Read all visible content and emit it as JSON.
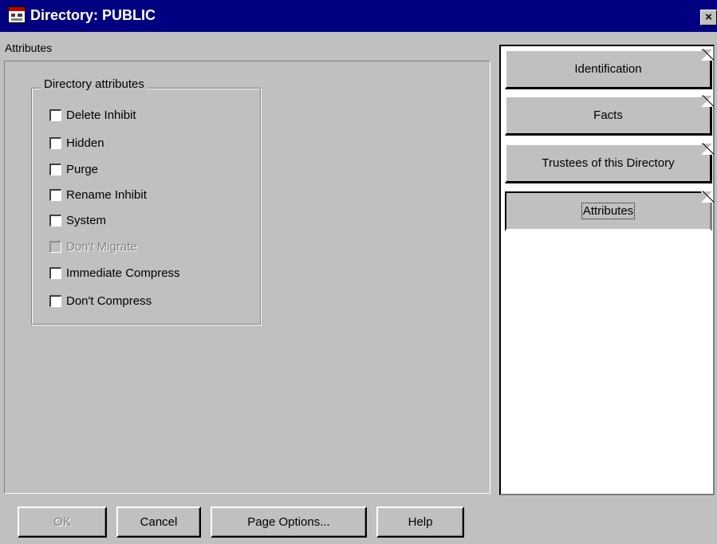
{
  "window": {
    "title": "Directory: PUBLIC",
    "close_label": "×"
  },
  "page": {
    "label": "Attributes",
    "group_title": "Directory attributes",
    "attributes": [
      {
        "label": "Delete Inhibit",
        "checked": false,
        "disabled": false
      },
      {
        "label": "Hidden",
        "checked": false,
        "disabled": false
      },
      {
        "label": "Purge",
        "checked": false,
        "disabled": false
      },
      {
        "label": "Rename Inhibit",
        "checked": false,
        "disabled": false
      },
      {
        "label": "System",
        "checked": false,
        "disabled": false
      },
      {
        "label": "Don't Migrate",
        "checked": false,
        "disabled": true
      },
      {
        "label": "Immediate Compress",
        "checked": false,
        "disabled": false
      },
      {
        "label": "Don't Compress",
        "checked": false,
        "disabled": false
      }
    ]
  },
  "tabs": [
    {
      "label": "Identification",
      "active": false
    },
    {
      "label": "Facts",
      "active": false
    },
    {
      "label": "Trustees of this Directory",
      "active": false
    },
    {
      "label": "Attributes",
      "active": true
    }
  ],
  "buttons": {
    "ok": "OK",
    "cancel": "Cancel",
    "page_options": "Page Options...",
    "help": "Help"
  },
  "colors": {
    "titlebar": "#000080",
    "face": "#c0c0c0"
  },
  "icons": {
    "window": "directory-window-icon",
    "close": "close-icon"
  }
}
